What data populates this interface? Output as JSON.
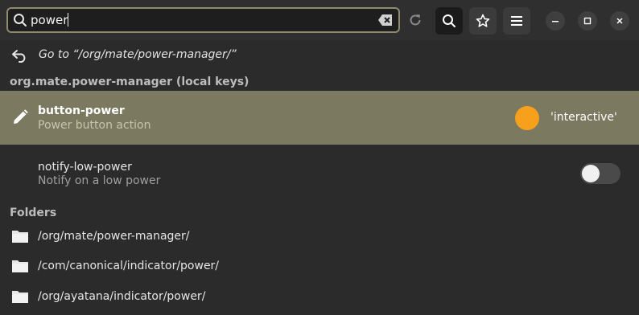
{
  "search": {
    "query": "power"
  },
  "goto": {
    "label": "Go to “/org/mate/power-manager/”"
  },
  "keys_section": {
    "title": "org.mate.power-manager (local keys)"
  },
  "keys": [
    {
      "name": "button-power",
      "description": "Power button action",
      "value": "'interactive'",
      "modified_indicator_color": "#f7a01b",
      "selected": true
    },
    {
      "name": "notify-low-power",
      "description": "Notify on a low power",
      "toggle_on": false
    }
  ],
  "folders_section": {
    "title": "Folders"
  },
  "folders": [
    {
      "path": "/org/mate/power-manager/"
    },
    {
      "path": "/com/canonical/indicator/power/"
    },
    {
      "path": "/org/ayatana/indicator/power/"
    }
  ],
  "colors": {
    "accent_border": "#8f8c6e",
    "selected_row": "#7b7960",
    "background": "#2b2b2b"
  },
  "icons": {
    "search": "search-icon",
    "clear": "clear-text-icon",
    "reload": "reload-icon",
    "search_toggle": "search-icon",
    "bookmarks": "star-icon",
    "menu": "hamburger-menu-icon",
    "minimize": "minimize-icon",
    "maximize": "maximize-icon",
    "close": "close-icon",
    "back": "back-arrow-icon",
    "edit": "pencil-icon",
    "folder": "folder-icon"
  }
}
